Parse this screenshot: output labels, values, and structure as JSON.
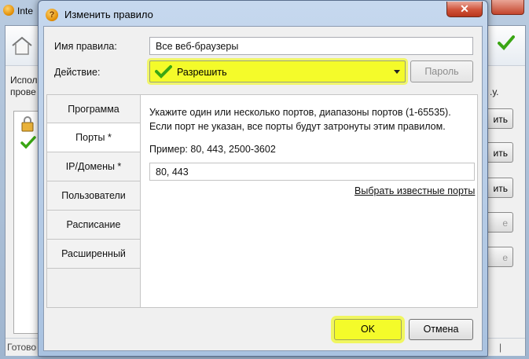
{
  "background_window": {
    "title": "Inte",
    "description_lines": [
      "Испол",
      "прове"
    ],
    "description_tail": ".у.",
    "side_buttons": [
      "ить",
      "ить",
      "ить",
      "е",
      "е"
    ],
    "status": "Готово",
    "status_separator": "|"
  },
  "dialog": {
    "title": "Изменить правило",
    "close_glyph": "✕",
    "rule_name_label": "Имя правила:",
    "rule_name_value": "Все веб-браузеры",
    "action_label": "Действие:",
    "action_value": "Разрешить",
    "password_button": "Пароль",
    "tabs": [
      {
        "label": "Программа"
      },
      {
        "label": "Порты *"
      },
      {
        "label": "IP/Домены *"
      },
      {
        "label": "Пользователи"
      },
      {
        "label": "Расписание"
      },
      {
        "label": "Расширенный"
      }
    ],
    "active_tab": "Порты *",
    "ports_panel": {
      "description": "Укажите один или несколько портов, диапазоны портов (1-65535). Если порт не указан, все порты будут затронуты этим правилом.",
      "example": "Пример: 80, 443, 2500-3602",
      "ports_value": "80, 443",
      "known_ports_link": "Выбрать известные порты"
    },
    "ok_button": "OK",
    "cancel_button": "Отмена"
  },
  "colors": {
    "highlight": "#f4fb2a",
    "check_green": "#3aa614"
  }
}
